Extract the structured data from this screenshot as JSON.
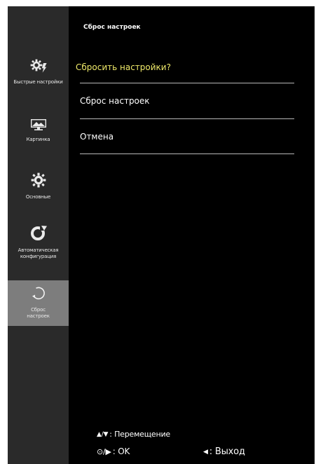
{
  "header": {
    "title": "Сброс настроек"
  },
  "sidebar": {
    "items": [
      {
        "label": "Быстрые настройки",
        "icon": "quick-settings-icon",
        "active": false
      },
      {
        "label": "Картинка",
        "icon": "picture-icon",
        "active": false
      },
      {
        "label": "Основные",
        "icon": "gear-icon",
        "active": false
      },
      {
        "label": "Автоматическая\nконфигурация",
        "icon": "auto-config-icon",
        "active": false
      },
      {
        "label": "Сброс\nнастроек",
        "icon": "reset-icon",
        "active": true
      }
    ]
  },
  "main": {
    "question": "Сбросить настройки?",
    "options": [
      {
        "label": "Сброс настроек"
      },
      {
        "label": "Отмена"
      }
    ]
  },
  "footer": {
    "move_label": ": Перемещение",
    "ok_label": ": OK",
    "exit_label": ": Выход"
  },
  "colors": {
    "background": "#000000",
    "sidebar": "#2a2a2a",
    "active_item": "#7d7d7d",
    "question_text": "#f0ea6a",
    "divider": "#b8b8b8"
  }
}
